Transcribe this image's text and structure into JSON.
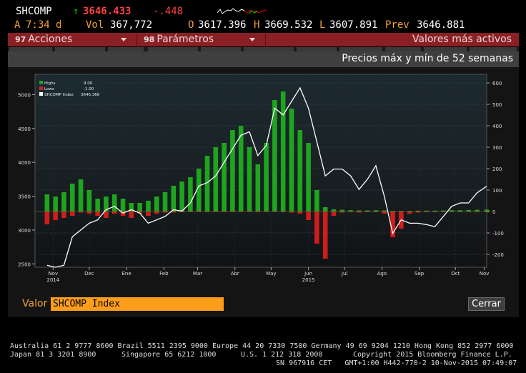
{
  "ticker": {
    "symbol": "SHCOMP",
    "arrow": "↑",
    "last": "3646.433",
    "change": "-.448",
    "time_prefix": "A",
    "time": "7:34",
    "time_suffix": "d",
    "vol_label": "Vol",
    "vol": "367,772",
    "open_label": "O",
    "open": "3617.396",
    "high_label": "H",
    "high": "3669.532",
    "low_label": "L",
    "low": "3607.891",
    "prev_label": "Prev",
    "prev": "3646.881",
    "colors": {
      "up": "#00c800",
      "down": "#ff3b3b",
      "last": "#ff4040"
    }
  },
  "menu": {
    "acciones": {
      "num": "97",
      "label": "Acciones"
    },
    "parametros": {
      "num": "98",
      "label": "Parámetros"
    },
    "right_label": "Valores más activos"
  },
  "panel": {
    "title": "Precios máx y mín de 52 semanas"
  },
  "legend": {
    "highs_label": "Highs",
    "highs_value": "9.00",
    "lows_label": "Lows",
    "lows_value": "-1.00",
    "index_label": "SHCOMP Index",
    "index_value": "3646.366"
  },
  "chart_data": {
    "type": "line",
    "series": [
      {
        "name": "SHCOMP Index",
        "axis": "left",
        "kind": "line",
        "x": [
          "2014-11-10",
          "2014-11-17",
          "2014-11-24",
          "2014-12-01",
          "2014-12-08",
          "2014-12-15",
          "2014-12-22",
          "2014-12-29",
          "2015-01-05",
          "2015-01-12",
          "2015-01-19",
          "2015-01-26",
          "2015-02-02",
          "2015-02-09",
          "2015-02-16",
          "2015-02-23",
          "2015-03-02",
          "2015-03-09",
          "2015-03-16",
          "2015-03-23",
          "2015-03-30",
          "2015-04-06",
          "2015-04-13",
          "2015-04-20",
          "2015-04-27",
          "2015-05-04",
          "2015-05-11",
          "2015-05-18",
          "2015-05-25",
          "2015-06-01",
          "2015-06-08",
          "2015-06-15",
          "2015-06-22",
          "2015-06-29",
          "2015-07-06",
          "2015-07-13",
          "2015-07-20",
          "2015-07-27",
          "2015-08-03",
          "2015-08-10",
          "2015-08-17",
          "2015-08-24",
          "2015-08-31",
          "2015-09-07",
          "2015-09-14",
          "2015-09-21",
          "2015-09-28",
          "2015-10-05",
          "2015-10-12",
          "2015-10-19",
          "2015-10-26",
          "2015-11-02",
          "2015-11-10"
        ],
        "values": [
          2480,
          2450,
          2480,
          2900,
          3000,
          3100,
          3150,
          3300,
          3350,
          3250,
          3300,
          3250,
          3100,
          3150,
          3200,
          3300,
          3280,
          3400,
          3650,
          3700,
          3800,
          4000,
          4200,
          4400,
          4450,
          4100,
          4250,
          4800,
          4700,
          4900,
          5100,
          4800,
          4300,
          3800,
          3900,
          3900,
          3800,
          3600,
          3750,
          3950,
          3500,
          2950,
          3150,
          3100,
          3100,
          3080,
          3050,
          3200,
          3350,
          3400,
          3400,
          3550,
          3646
        ]
      },
      {
        "name": "Highs",
        "axis": "right",
        "kind": "bar",
        "color": "#1ea51e",
        "x": [
          "2014-11-10",
          "2014-11-17",
          "2014-11-24",
          "2014-12-01",
          "2014-12-08",
          "2014-12-15",
          "2014-12-22",
          "2014-12-29",
          "2015-01-05",
          "2015-01-12",
          "2015-01-19",
          "2015-01-26",
          "2015-02-02",
          "2015-02-09",
          "2015-02-16",
          "2015-02-23",
          "2015-03-02",
          "2015-03-09",
          "2015-03-16",
          "2015-03-23",
          "2015-03-30",
          "2015-04-06",
          "2015-04-13",
          "2015-04-20",
          "2015-04-27",
          "2015-05-04",
          "2015-05-11",
          "2015-05-18",
          "2015-05-25",
          "2015-06-01",
          "2015-06-08",
          "2015-06-15",
          "2015-06-22",
          "2015-06-29",
          "2015-07-06",
          "2015-07-13",
          "2015-07-20",
          "2015-07-27",
          "2015-08-03",
          "2015-08-10",
          "2015-08-17",
          "2015-08-24",
          "2015-08-31",
          "2015-09-07",
          "2015-09-14",
          "2015-09-21",
          "2015-09-28",
          "2015-10-05",
          "2015-10-12",
          "2015-10-19",
          "2015-10-26",
          "2015-11-02",
          "2015-11-10"
        ],
        "values": [
          80,
          70,
          90,
          130,
          150,
          100,
          60,
          70,
          80,
          60,
          40,
          40,
          50,
          70,
          90,
          120,
          140,
          160,
          200,
          260,
          300,
          320,
          380,
          400,
          300,
          220,
          320,
          520,
          560,
          480,
          380,
          320,
          100,
          20,
          10,
          8,
          6,
          5,
          5,
          6,
          5,
          3,
          3,
          3,
          4,
          4,
          4,
          5,
          6,
          6,
          7,
          8,
          9
        ]
      },
      {
        "name": "Lows",
        "axis": "right",
        "kind": "bar",
        "color": "#d01c1c",
        "x": [
          "2014-11-10",
          "2014-11-17",
          "2014-11-24",
          "2014-12-01",
          "2014-12-08",
          "2014-12-15",
          "2014-12-22",
          "2014-12-29",
          "2015-01-05",
          "2015-01-12",
          "2015-01-19",
          "2015-01-26",
          "2015-02-02",
          "2015-02-09",
          "2015-02-16",
          "2015-02-23",
          "2015-03-02",
          "2015-03-09",
          "2015-03-16",
          "2015-03-23",
          "2015-03-30",
          "2015-04-06",
          "2015-04-13",
          "2015-04-20",
          "2015-04-27",
          "2015-05-04",
          "2015-05-11",
          "2015-05-18",
          "2015-05-25",
          "2015-06-01",
          "2015-06-08",
          "2015-06-15",
          "2015-06-22",
          "2015-06-29",
          "2015-07-06",
          "2015-07-13",
          "2015-07-20",
          "2015-07-27",
          "2015-08-03",
          "2015-08-10",
          "2015-08-17",
          "2015-08-24",
          "2015-08-31",
          "2015-09-07",
          "2015-09-14",
          "2015-09-21",
          "2015-09-28",
          "2015-10-05",
          "2015-10-12",
          "2015-10-19",
          "2015-10-26",
          "2015-11-02",
          "2015-11-10"
        ],
        "values": [
          -60,
          -40,
          -30,
          -20,
          -5,
          -10,
          -20,
          -30,
          -10,
          -20,
          -30,
          -10,
          -20,
          -10,
          -5,
          -5,
          -3,
          -2,
          -2,
          -2,
          -2,
          -2,
          -2,
          -2,
          -2,
          -2,
          -2,
          -2,
          -3,
          -5,
          -10,
          -40,
          -150,
          -220,
          -20,
          -5,
          -3,
          -5,
          -3,
          -3,
          -10,
          -120,
          -80,
          -10,
          -5,
          -3,
          -3,
          -2,
          -1,
          -1,
          -1,
          -1,
          -1
        ]
      }
    ],
    "y_left": {
      "ticks": [
        2500,
        3000,
        3500,
        4000,
        4500,
        5000
      ],
      "range": [
        2450,
        5300
      ]
    },
    "y_right": {
      "ticks": [
        -200,
        -100,
        0,
        100,
        200,
        300,
        400,
        500,
        600
      ],
      "range": [
        -260,
        640
      ]
    },
    "x_range": [
      "2014-10-31",
      "2015-11-10"
    ],
    "x_ticks": [
      {
        "date": "2014-11-15",
        "label": "Nov"
      },
      {
        "date": "2014-12-15",
        "label": "Dec"
      },
      {
        "date": "2015-01-15",
        "label": "Ene"
      },
      {
        "date": "2015-02-15",
        "label": "Feb"
      },
      {
        "date": "2015-03-15",
        "label": "Mar"
      },
      {
        "date": "2015-04-15",
        "label": "Abr"
      },
      {
        "date": "2015-05-15",
        "label": "May"
      },
      {
        "date": "2015-06-15",
        "label": "Jun"
      },
      {
        "date": "2015-07-15",
        "label": "Jul"
      },
      {
        "date": "2015-08-15",
        "label": "Ago"
      },
      {
        "date": "2015-09-15",
        "label": "Sep"
      },
      {
        "date": "2015-10-15",
        "label": "Oct"
      },
      {
        "date": "2015-11-08",
        "label": "Nov"
      }
    ],
    "year_labels": [
      {
        "date": "2014-11-15",
        "label": "2014"
      },
      {
        "date": "2015-06-15",
        "label": "2015"
      }
    ],
    "grid": true,
    "legend_position": "top-left"
  },
  "input": {
    "label": "Valor",
    "value": "SHCOMP Index"
  },
  "close_button": "Cerrar",
  "footer": {
    "line1": "Australia 61 2 9777 8600 Brazil 5511 2395 9000 Europe 44 20 7330 7500 Germany 49 69 9204 1210 Hong Kong 852 2977 6000",
    "line2a": "Japan 81 3 3201 8900",
    "line2b": "Singapore 65 6212 1000",
    "line2c": "U.S. 1 212 318 2000",
    "line2d": "Copyright 2015 Bloomberg Finance L.P.",
    "line3": "SN 967916 CET   GMT+1:00 H442-770-2 10-Nov-2015 07:49:07"
  }
}
